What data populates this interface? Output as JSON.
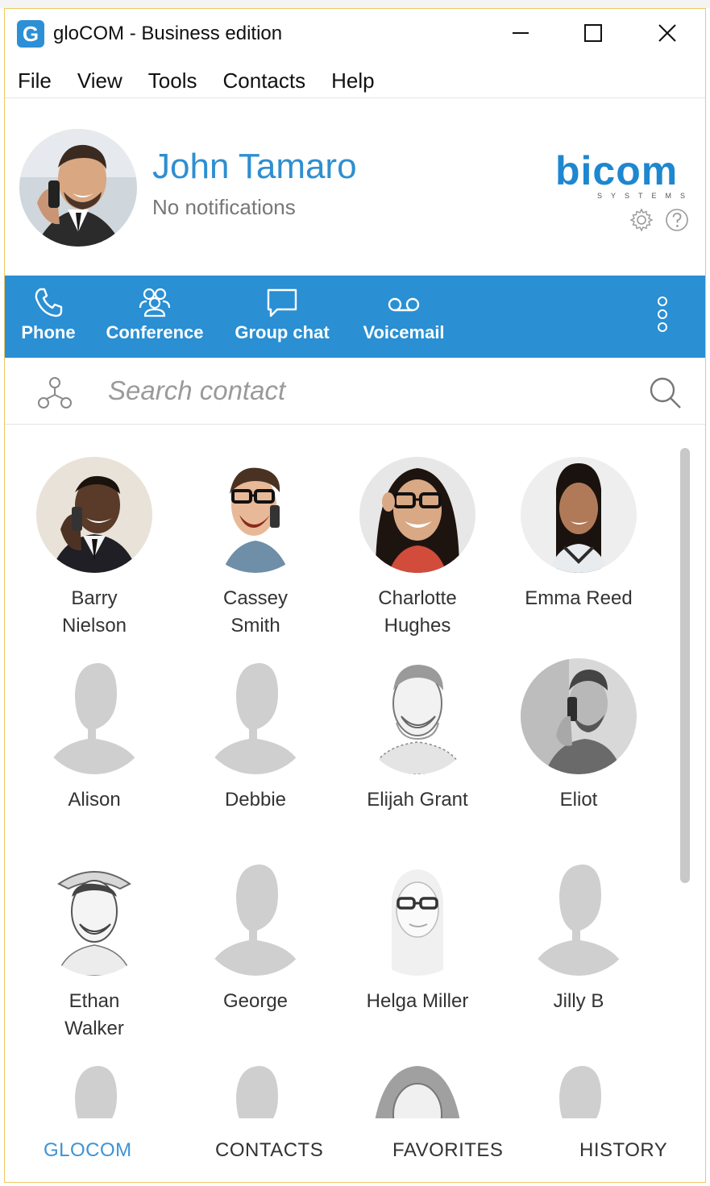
{
  "window": {
    "title": "gloCOM - Business edition",
    "app_icon_letter": "G"
  },
  "menu": [
    "File",
    "View",
    "Tools",
    "Contacts",
    "Help"
  ],
  "profile": {
    "name": "John Tamaro",
    "status": "No notifications"
  },
  "brand": {
    "logo": "bicom",
    "sub": "SYSTEMS"
  },
  "actions": [
    {
      "label": "Phone",
      "icon": "phone-icon"
    },
    {
      "label": "Conference",
      "icon": "conference-icon"
    },
    {
      "label": "Group chat",
      "icon": "chat-bubble-icon"
    },
    {
      "label": "Voicemail",
      "icon": "voicemail-icon"
    }
  ],
  "search": {
    "placeholder": "Search contact"
  },
  "contacts": [
    {
      "name": "Barry\nNielson",
      "photo": "color-man-dark"
    },
    {
      "name": "Cassey\nSmith",
      "photo": "color-man-glasses"
    },
    {
      "name": "Charlotte\nHughes",
      "photo": "color-woman-glasses"
    },
    {
      "name": "Emma Reed",
      "photo": "color-woman"
    },
    {
      "name": "Alison",
      "photo": "placeholder"
    },
    {
      "name": "Debbie",
      "photo": "placeholder"
    },
    {
      "name": "Elijah Grant",
      "photo": "sketch-man"
    },
    {
      "name": "Eliot",
      "photo": "gray-man-phone"
    },
    {
      "name": "Ethan\nWalker",
      "photo": "sketch-man-hat"
    },
    {
      "name": "George",
      "photo": "placeholder"
    },
    {
      "name": "Helga Miller",
      "photo": "sketch-woman-glasses"
    },
    {
      "name": "Jilly B",
      "photo": "placeholder"
    },
    {
      "name": "",
      "photo": "placeholder"
    },
    {
      "name": "",
      "photo": "placeholder"
    },
    {
      "name": "",
      "photo": "sketch-woman"
    },
    {
      "name": "",
      "photo": "placeholder"
    }
  ],
  "tabs": [
    {
      "label": "GLOCOM",
      "active": true
    },
    {
      "label": "CONTACTS",
      "active": false
    },
    {
      "label": "FAVORITES",
      "active": false
    },
    {
      "label": "HISTORY",
      "active": false
    }
  ],
  "colors": {
    "accent": "#2a8fd3",
    "name": "#2e8fd0",
    "window_border": "#f0c862",
    "placeholder": "#cfcfcf"
  }
}
